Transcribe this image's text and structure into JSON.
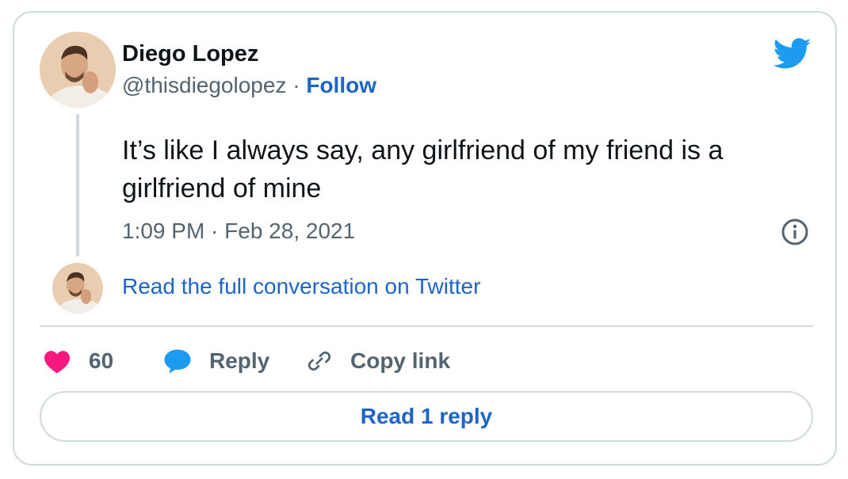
{
  "tweet": {
    "author_name": "Diego Lopez",
    "handle": "@thisdiegolopez",
    "separator": "·",
    "follow_label": "Follow",
    "text": "It’s like I always say, any girlfriend of my friend is a girlfriend of mine",
    "timestamp": "1:09 PM · Feb 28, 2021"
  },
  "conversation": {
    "read_full_label": "Read the full conversation on Twitter"
  },
  "actions": {
    "likes_count": "60",
    "reply_label": "Reply",
    "copy_link_label": "Copy link"
  },
  "footer": {
    "read_reply_label": "Read 1 reply"
  },
  "icons": {
    "brand": "twitter-bird-icon",
    "info": "info-icon",
    "like": "heart-icon",
    "reply": "speech-bubble-icon",
    "copy": "link-icon"
  },
  "colors": {
    "brand_blue": "#1d9bf0",
    "link_blue": "#1d64c8",
    "like_pink": "#f91880",
    "text_primary": "#0f1419",
    "text_secondary": "#536471",
    "border": "#cfd9de"
  }
}
